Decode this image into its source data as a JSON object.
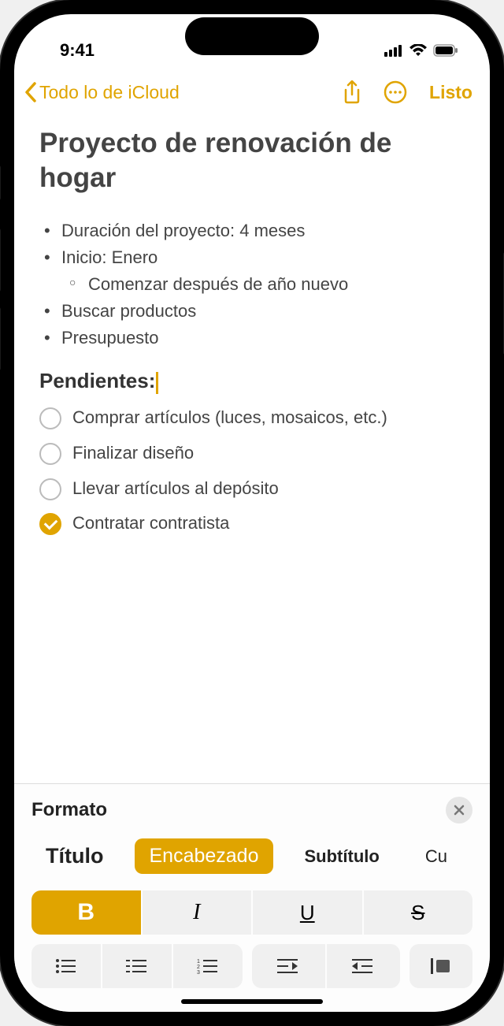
{
  "status": {
    "time": "9:41"
  },
  "nav": {
    "back_label": "Todo lo de iCloud",
    "done_label": "Listo"
  },
  "note": {
    "title": "Proyecto de renovación de hogar",
    "bullets": [
      "Duración del proyecto: 4 meses",
      "Inicio: Enero",
      "Comenzar después de año nuevo",
      "Buscar productos",
      "Presupuesto"
    ],
    "heading": "Pendientes:",
    "checklist": [
      {
        "label": "Comprar artículos (luces, mosaicos, etc.)",
        "checked": false
      },
      {
        "label": "Finalizar diseño",
        "checked": false
      },
      {
        "label": "Llevar artículos al depósito",
        "checked": false
      },
      {
        "label": "Contratar contratista",
        "checked": true
      }
    ]
  },
  "format": {
    "panel_title": "Formato",
    "styles": {
      "title": "Título",
      "heading": "Encabezado",
      "subtitle": "Subtítulo",
      "body_cut": "Cu"
    },
    "buttons": {
      "bold": "B",
      "italic": "I",
      "underline": "U",
      "strike": "S"
    }
  },
  "colors": {
    "accent": "#e0a400"
  }
}
